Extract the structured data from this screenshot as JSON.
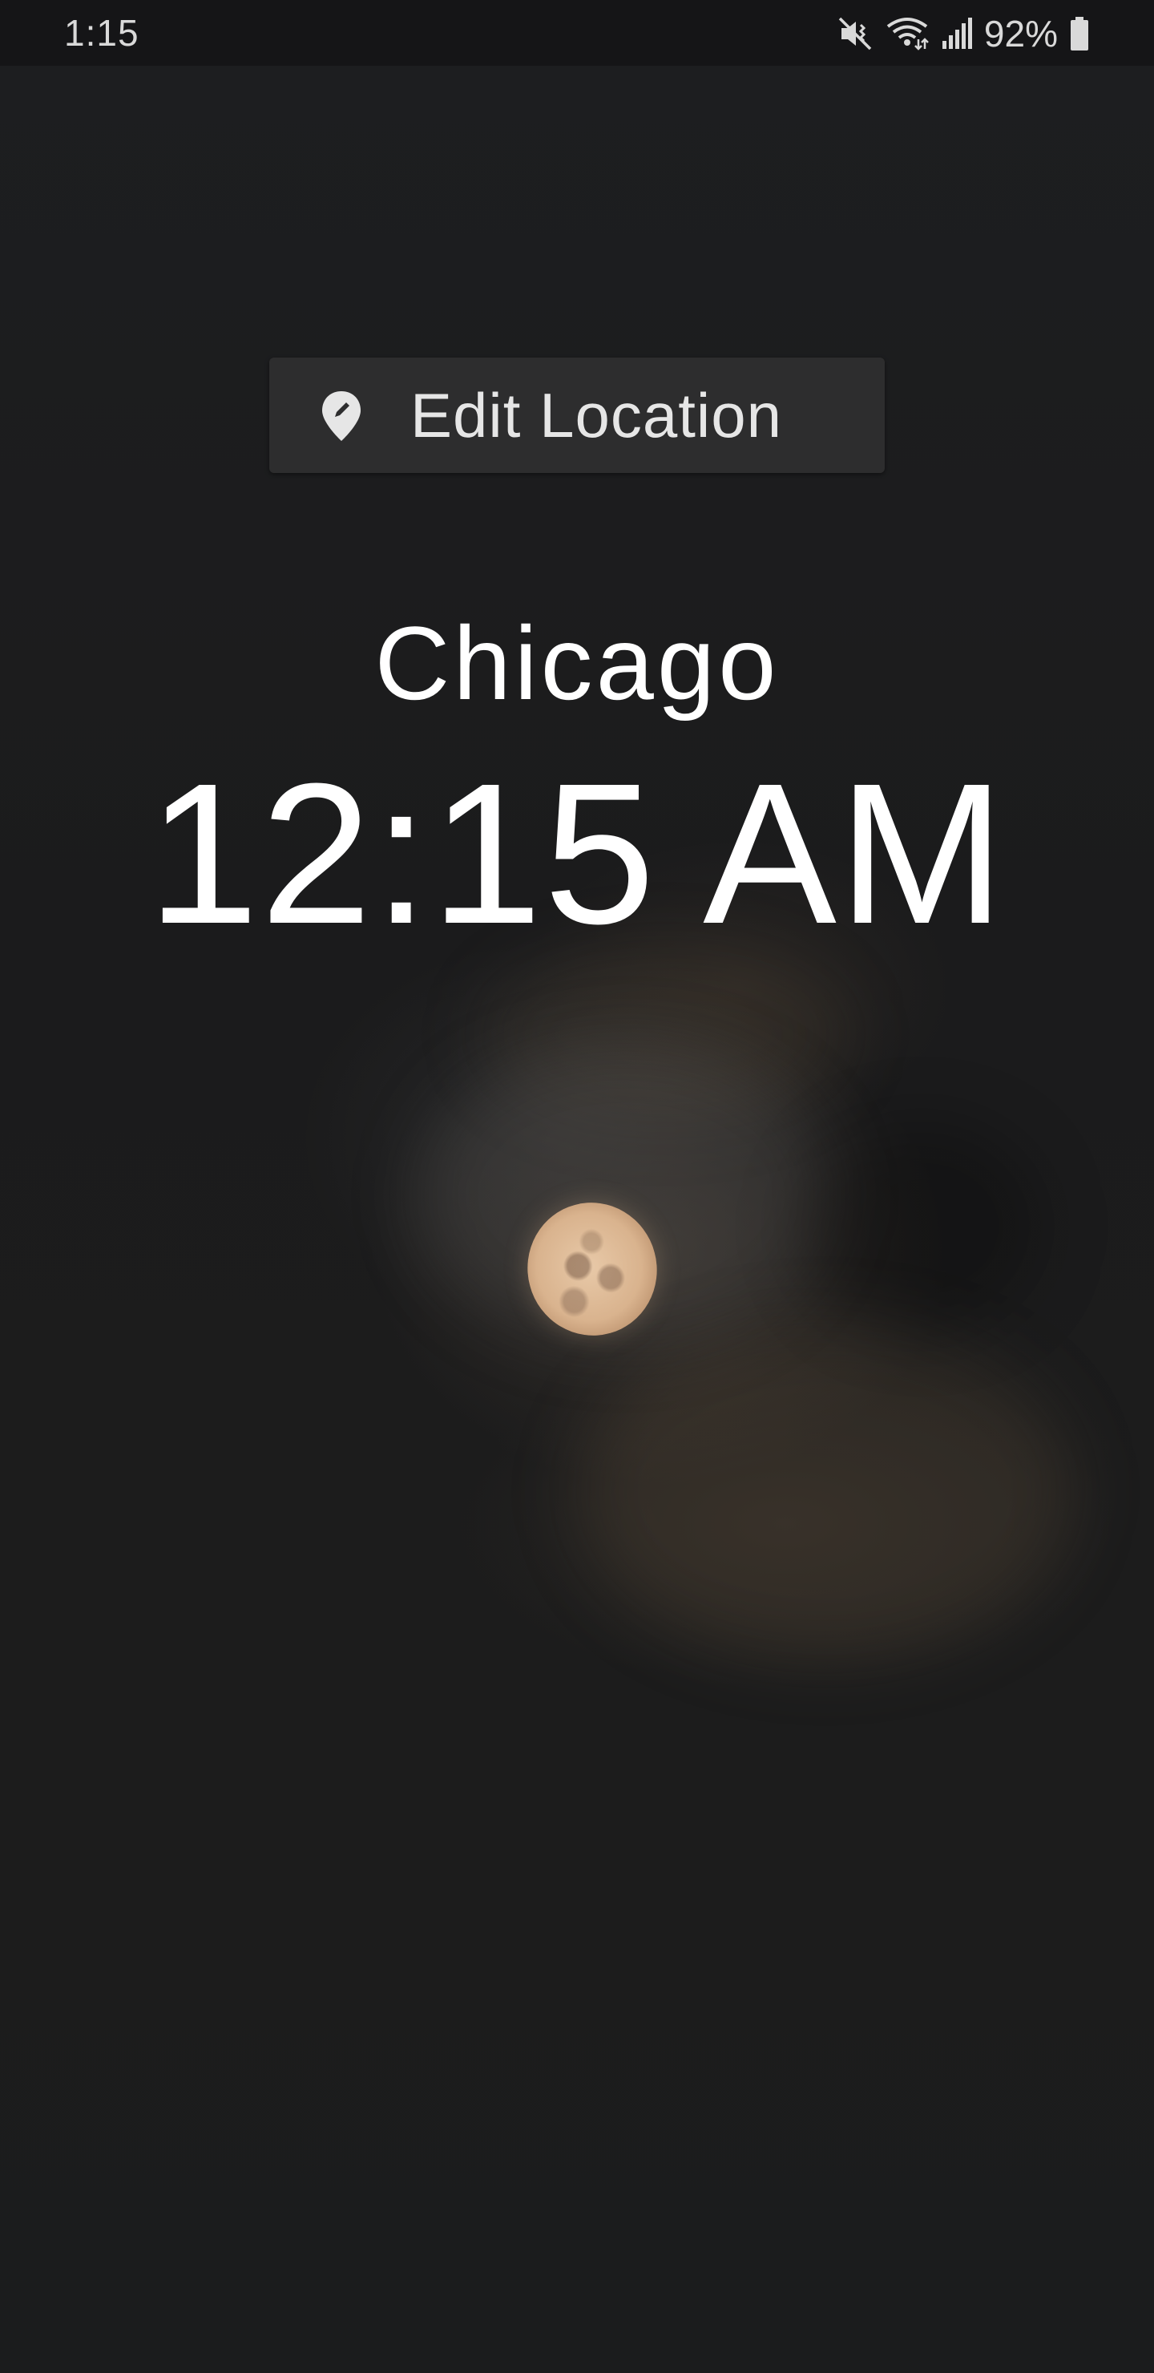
{
  "status_bar": {
    "time": "1:15",
    "battery": "92%",
    "icons": [
      "mute-vibrate-icon",
      "wifi-icon",
      "signal-icon",
      "battery-icon"
    ]
  },
  "edit_location": {
    "label": "Edit Location",
    "icon": "location-edit-icon"
  },
  "city": "Chicago",
  "clock": "12:15 AM",
  "colors": {
    "background": "#1c1d1f",
    "button_bg": "#2d2d2e",
    "text": "#ffffff"
  }
}
